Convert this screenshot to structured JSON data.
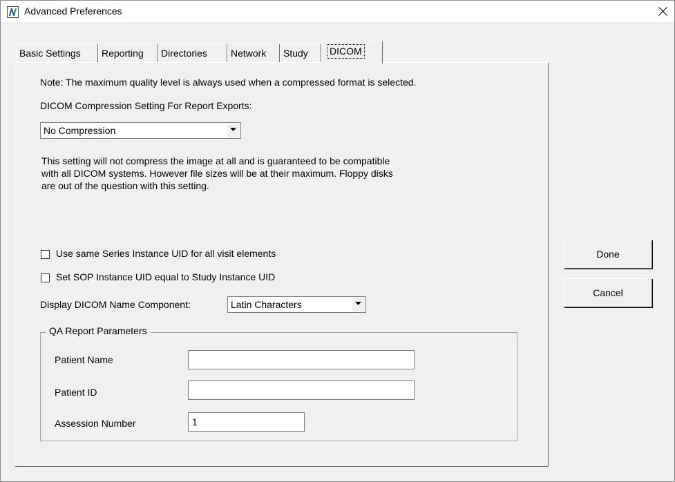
{
  "window": {
    "title": "Advanced Preferences",
    "app_icon": "nova-n-icon",
    "close_icon": "close-icon"
  },
  "tabs": [
    {
      "label": "Basic Settings",
      "active": false
    },
    {
      "label": "Reporting",
      "active": false
    },
    {
      "label": "Directories",
      "active": false
    },
    {
      "label": "Network",
      "active": false
    },
    {
      "label": "Study",
      "active": false
    },
    {
      "label": "DICOM",
      "active": true
    }
  ],
  "dicom": {
    "note": "Note: The maximum quality level is always used when a compressed format is selected.",
    "compression_label": "DICOM Compression Setting For Report Exports:",
    "compression_value": "No Compression",
    "description_lines": [
      "This setting will not compress the image at all and is guaranteed to be compatible",
      "with all DICOM systems.  However file sizes will be at their maximum.  Floppy disks",
      "are out of the question with this setting."
    ],
    "checkboxes": [
      {
        "label": "Use same Series Instance UID for all  visit elements",
        "checked": false
      },
      {
        "label": "Set SOP Instance UID equal to Study Instance UID",
        "checked": false
      }
    ],
    "name_component_label": "Display DICOM Name Component:",
    "name_component_value": "Latin Characters",
    "qa_group": {
      "title": "QA Report Parameters",
      "fields": [
        {
          "label": "Patient Name",
          "value": ""
        },
        {
          "label": "Patient ID",
          "value": ""
        },
        {
          "label": "Assession Number",
          "value": "1"
        }
      ]
    }
  },
  "buttons": {
    "done": "Done",
    "cancel": "Cancel"
  },
  "colors": {
    "icon_blue": "#1d4ea8",
    "icon_green": "#2e9a3a"
  }
}
